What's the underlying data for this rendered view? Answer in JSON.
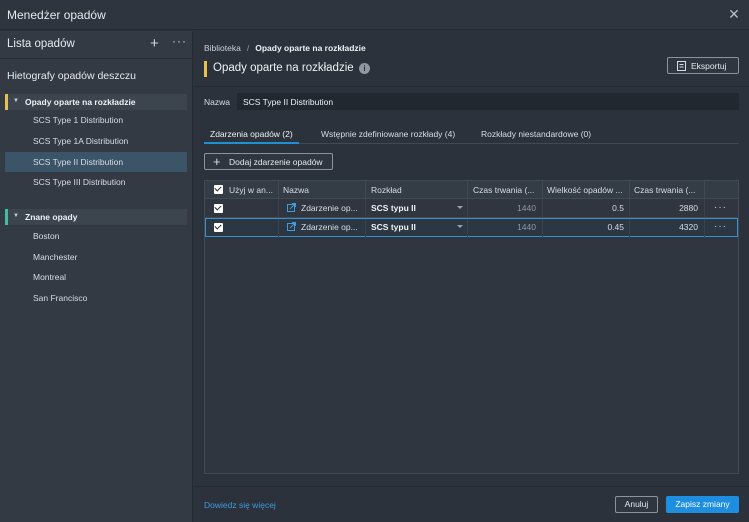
{
  "window": {
    "title": "Menedżer opadów",
    "close_icon": "close-icon"
  },
  "left_panel": {
    "title": "Lista opadów",
    "add_icon": "plus-icon",
    "more_icon": "more-icon",
    "subtitle": "Hietografy opadów deszczu",
    "groups": [
      {
        "label": "Opady oparte na rozkładzie",
        "marker_color": "#e8c04a",
        "items": [
          {
            "label": "SCS Type 1 Distribution"
          },
          {
            "label": "SCS Type 1A Distribution"
          },
          {
            "label": "SCS Type II Distribution",
            "selected": true
          },
          {
            "label": "SCS Type III Distribution"
          }
        ]
      },
      {
        "label": "Znane opady",
        "marker_color": "#3cc0a0",
        "items": [
          {
            "label": "Boston"
          },
          {
            "label": "Manchester"
          },
          {
            "label": "Montreal"
          },
          {
            "label": "San Francisco"
          }
        ]
      }
    ]
  },
  "main": {
    "breadcrumb": {
      "root": "Biblioteka",
      "separator": "/",
      "current": "Opady oparte na rozkładzie"
    },
    "title": "Opady oparte na rozkładzie",
    "export_label": "Eksportuj",
    "name_label": "Nazwa",
    "name_value": "SCS Type II Distribution",
    "tabs": [
      {
        "label": "Zdarzenia opadów (2)",
        "active": true
      },
      {
        "label": "Wstępnie zdefiniowane rozkłady (4)"
      },
      {
        "label": "Rozkłady niestandardowe (0)"
      }
    ],
    "add_event_label": "Dodaj zdarzenie opadów",
    "table": {
      "headers": [
        "Użyj w an...",
        "Nazwa",
        "Rozkład",
        "Czas trwania (...",
        "Wielkość opadów ...",
        "Czas trwania (..."
      ],
      "rows": [
        {
          "checked": true,
          "name": "Zdarzenie op...",
          "distribution": "SCS typu II",
          "duration": "1440",
          "depth": "0.5",
          "duration2": "2880",
          "selected": false
        },
        {
          "checked": true,
          "name": "Zdarzenie op...",
          "distribution": "SCS typu II",
          "duration": "1440",
          "depth": "0.45",
          "duration2": "4320",
          "selected": true
        }
      ]
    },
    "footer": {
      "learn_more": "Dowiedz się więcej",
      "cancel": "Anuluj",
      "save": "Zapisz zmiany"
    }
  },
  "colors": {
    "accent": "#1d8ee0",
    "selected_row": "#3b5468",
    "link": "#3f9ae0"
  }
}
